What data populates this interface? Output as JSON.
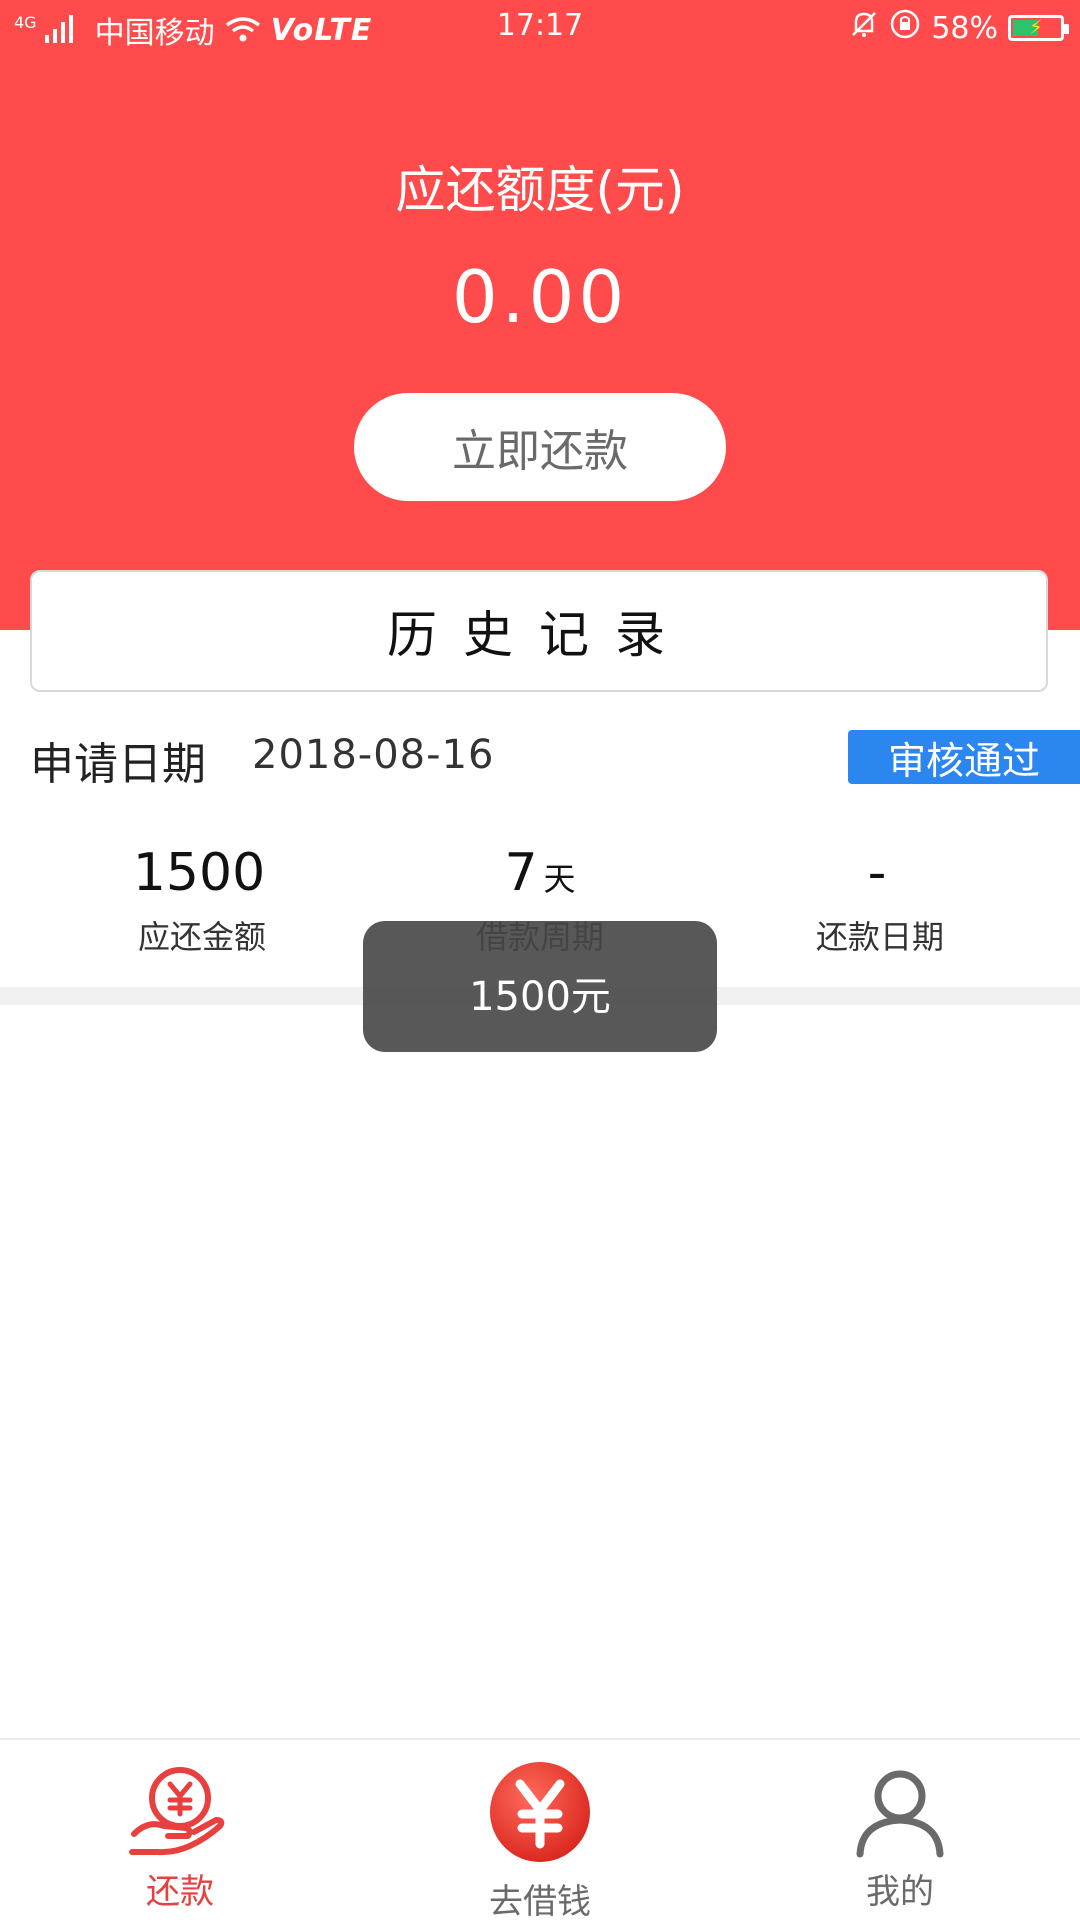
{
  "status_bar": {
    "network": "4G",
    "carrier": "中国移动",
    "volte": "VoLTE",
    "time": "17:17",
    "battery": "58%"
  },
  "header": {
    "title": "应还额度(元)",
    "amount": "0.00",
    "repay_button": "立即还款"
  },
  "history": {
    "title": "历史记录"
  },
  "record": {
    "apply_label": "申请日期",
    "apply_date": "2018-08-16",
    "status": "审核通过",
    "stats": [
      {
        "value": "1500",
        "unit": "",
        "label": "应还金额"
      },
      {
        "value": "7",
        "unit": "天",
        "label": "借款周期"
      },
      {
        "value": "-",
        "unit": "",
        "label": "还款日期"
      }
    ]
  },
  "toast": {
    "text": "1500元"
  },
  "tabbar": {
    "items": [
      {
        "label": "还款",
        "icon": "repay-hand-yen-icon",
        "active": true
      },
      {
        "label": "去借钱",
        "icon": "yen-coin-icon",
        "active": false
      },
      {
        "label": "我的",
        "icon": "user-icon",
        "active": false
      }
    ]
  },
  "colors": {
    "brand_red": "#ff4b4b",
    "badge_blue": "#2b86f0",
    "tab_active": "#e8403e",
    "tab_inactive": "#6a6a6a"
  }
}
